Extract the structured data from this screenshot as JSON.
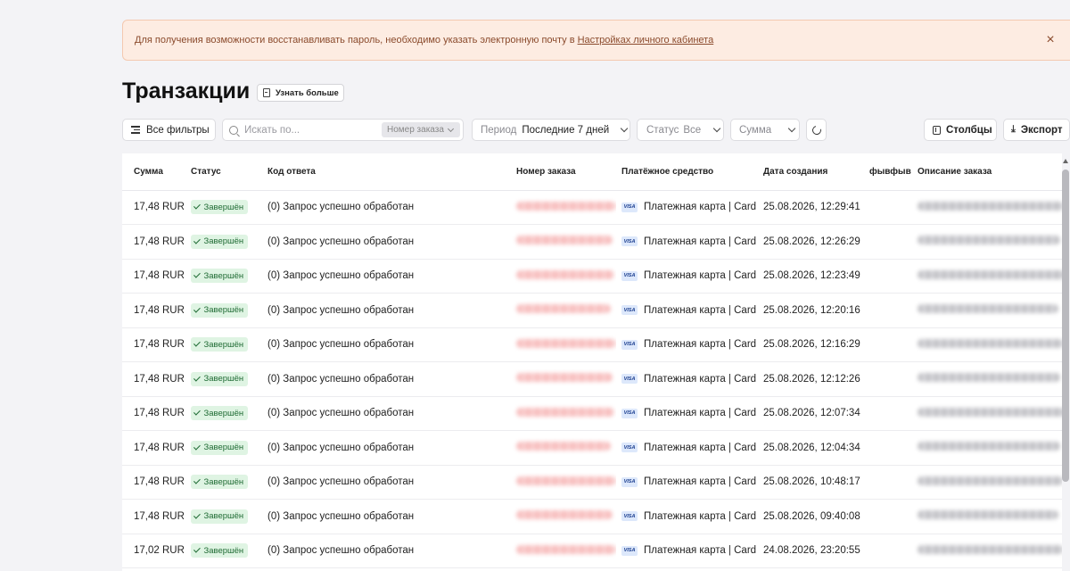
{
  "alert": {
    "text": "Для получения возможности восстанавливать пароль, необходимо указать электронную почту в",
    "link": "Настройках личного кабинета",
    "close": "×"
  },
  "page": {
    "title": "Транзакции",
    "learn_more": "Узнать больше"
  },
  "toolbar": {
    "filters": "Все фильтры",
    "search_placeholder": "Искать по...",
    "search_field": "Номер заказа",
    "period_label": "Период",
    "period_value": "Последние 7 дней",
    "status_label": "Статус",
    "status_value": "Все",
    "amount_label": "Сумма",
    "columns": "Столбцы",
    "export": "Экспорт"
  },
  "table": {
    "headers": {
      "amount": "Сумма",
      "status": "Статус",
      "code": "Код ответа",
      "order": "Номер заказа",
      "payment": "Платёжное средство",
      "date": "Дата создания",
      "custom": "фывфыв",
      "description": "Описание заказа"
    },
    "card_brand": "VISA",
    "rows": [
      {
        "amount": "17,48 RUR",
        "status": "Завершён",
        "code": "(0) Запрос успешно обработан",
        "payment": "Платежная карта | Card",
        "date": "25.08.2026, 12:29:41"
      },
      {
        "amount": "17,48 RUR",
        "status": "Завершён",
        "code": "(0) Запрос успешно обработан",
        "payment": "Платежная карта | Card",
        "date": "25.08.2026, 12:26:29"
      },
      {
        "amount": "17,48 RUR",
        "status": "Завершён",
        "code": "(0) Запрос успешно обработан",
        "payment": "Платежная карта | Card",
        "date": "25.08.2026, 12:23:49"
      },
      {
        "amount": "17,48 RUR",
        "status": "Завершён",
        "code": "(0) Запрос успешно обработан",
        "payment": "Платежная карта | Card",
        "date": "25.08.2026, 12:20:16"
      },
      {
        "amount": "17,48 RUR",
        "status": "Завершён",
        "code": "(0) Запрос успешно обработан",
        "payment": "Платежная карта | Card",
        "date": "25.08.2026, 12:16:29"
      },
      {
        "amount": "17,48 RUR",
        "status": "Завершён",
        "code": "(0) Запрос успешно обработан",
        "payment": "Платежная карта | Card",
        "date": "25.08.2026, 12:12:26"
      },
      {
        "amount": "17,48 RUR",
        "status": "Завершён",
        "code": "(0) Запрос успешно обработан",
        "payment": "Платежная карта | Card",
        "date": "25.08.2026, 12:07:34"
      },
      {
        "amount": "17,48 RUR",
        "status": "Завершён",
        "code": "(0) Запрос успешно обработан",
        "payment": "Платежная карта | Card",
        "date": "25.08.2026, 12:04:34"
      },
      {
        "amount": "17,48 RUR",
        "status": "Завершён",
        "code": "(0) Запрос успешно обработан",
        "payment": "Платежная карта | Card",
        "date": "25.08.2026, 10:48:17"
      },
      {
        "amount": "17,48 RUR",
        "status": "Завершён",
        "code": "(0) Запрос успешно обработан",
        "payment": "Платежная карта | Card",
        "date": "25.08.2026, 09:40:08"
      },
      {
        "amount": "17,02 RUR",
        "status": "Завершён",
        "code": "(0) Запрос успешно обработан",
        "payment": "Платежная карта | Card",
        "date": "24.08.2026, 23:20:55"
      }
    ]
  },
  "colors": {
    "accent_success_bg": "#dff4e3",
    "accent_success_text": "#1f6b34",
    "alert_bg": "#fdece2",
    "alert_text": "#8a4a2c"
  }
}
